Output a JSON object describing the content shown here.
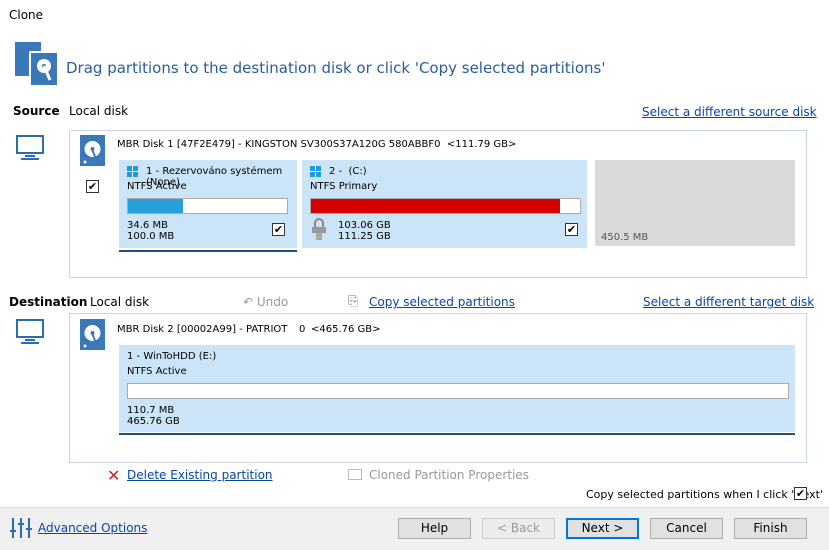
{
  "window": {
    "title": "Clone"
  },
  "header": {
    "instruction": "Drag partitions to the destination disk or click 'Copy selected partitions'"
  },
  "source": {
    "label": "Source",
    "disk_type": "Local disk",
    "change_link": "Select a different source disk",
    "disk": {
      "title": "MBR Disk 1 [47F2E479] - KINGSTON SV300S37A120G 580ABBF0  <111.79 GB>",
      "checked": true
    },
    "partitions": [
      {
        "name": "1 - Rezervováno systémem (None)",
        "type": "NTFS Active",
        "used": "34.6 MB",
        "total": "100.0 MB",
        "fill_percent": 34.6,
        "bar_color": "#26a0da",
        "checked": true
      },
      {
        "name": "2 -  (C:)",
        "type": "NTFS Primary",
        "used": "103.06 GB",
        "total": "111.25 GB",
        "fill_percent": 92.6,
        "bar_color": "#d40000",
        "checked": true
      }
    ],
    "unallocated": "450.5 MB"
  },
  "destination": {
    "label": "Destination",
    "disk_type": "Local disk",
    "undo": "Undo",
    "copy_link": "Copy selected partitions",
    "change_link": "Select a different target disk",
    "disk": {
      "title": "MBR Disk 2 [00002A99] - PATRIOT",
      "index": "0",
      "size": "<465.76 GB>"
    },
    "partitions": [
      {
        "name": "1 - WinToHDD (E:)",
        "type": "NTFS Active",
        "used": "110.7 MB",
        "total": "465.76 GB",
        "fill_percent": 0
      }
    ]
  },
  "actions": {
    "delete": "Delete Existing partition",
    "properties": "Cloned Partition Properties",
    "copy_on_next": "Copy selected partitions when I click 'Next'",
    "copy_on_next_checked": true
  },
  "footer": {
    "advanced": "Advanced Options",
    "help": "Help",
    "back": "< Back",
    "next": "Next >",
    "cancel": "Cancel",
    "finish": "Finish"
  }
}
